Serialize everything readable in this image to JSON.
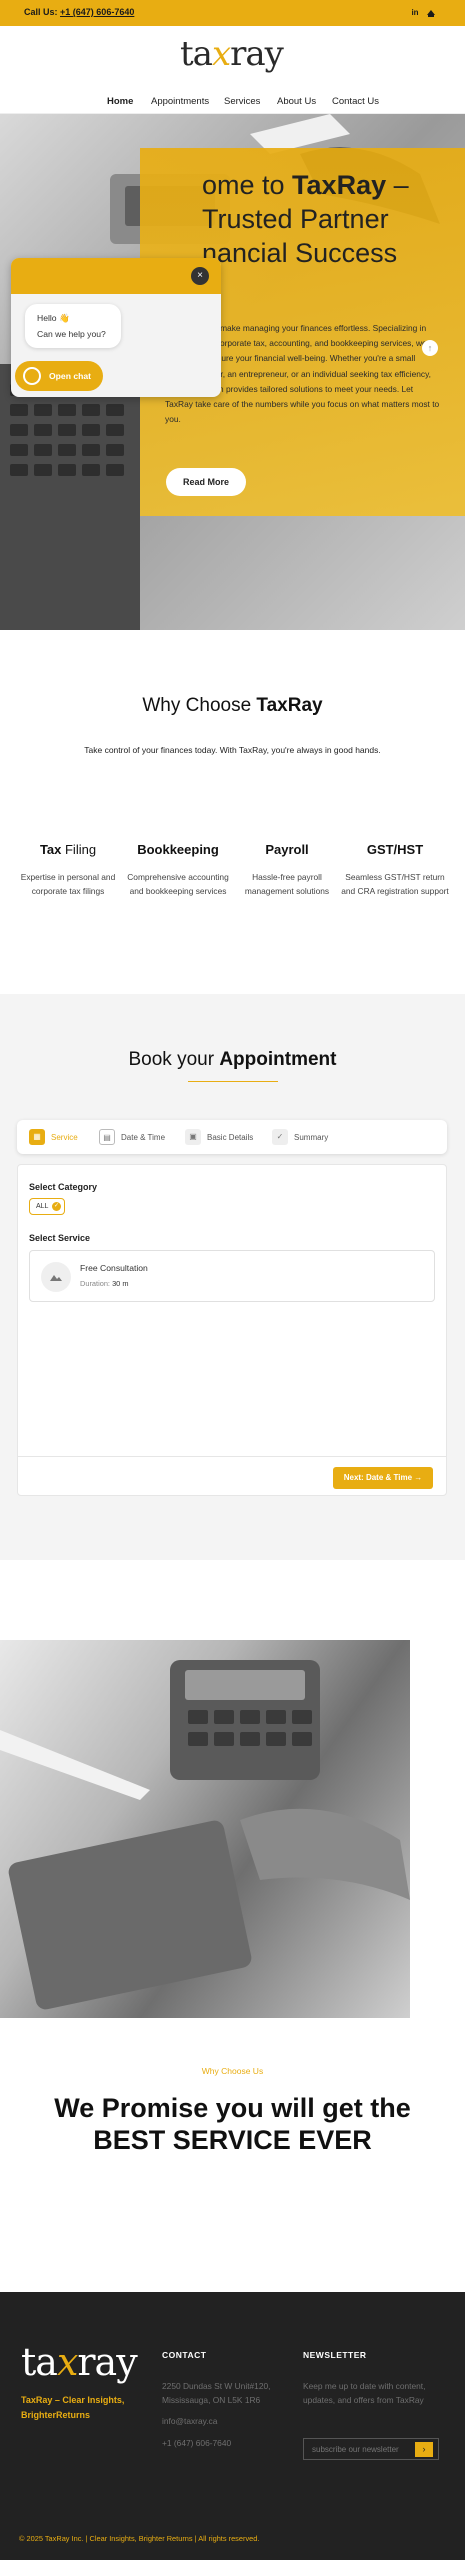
{
  "topbar": {
    "call_label": "Call Us:",
    "phone": "+1 (647) 606-7640",
    "social": [
      "in",
      "ig"
    ]
  },
  "brand": {
    "logo_left": "ta",
    "logo_x": "x",
    "logo_right": "ray",
    "accent": "#e8ad12"
  },
  "nav": {
    "items": [
      "Home",
      "Appointments",
      "Services",
      "About Us",
      "Contact Us"
    ]
  },
  "hero": {
    "title_l1_pre": "ome to ",
    "title_l1_bold": "TaxRay",
    "title_l1_post": " –",
    "title_l2": "Trusted Partner",
    "title_l3": "nancial Success",
    "text": "At TaxRay, we make managing your finances effortless. Specializing in personal and corporate tax, accounting, and bookkeeping services, we are here to ensure your financial well-being. Whether you're a small business owner, an entrepreneur, or an individual seeking tax efficiency, our expert team provides tailored solutions to meet your needs. Let TaxRay take care of the numbers while you focus on what matters most to you.",
    "cta": "Read More",
    "fab": "↑"
  },
  "chat": {
    "close": "×",
    "greeting_l1": "Hello 👋",
    "greeting_l2": "Can we help you?",
    "open_label": "Open chat"
  },
  "why": {
    "title_pre": "Why Choose ",
    "title_bold": "TaxRay",
    "subtitle": "Take control of your finances today. With TaxRay, you're always in good hands.",
    "services": [
      {
        "bold": "Tax",
        "rest": " Filing",
        "desc": "Expertise in personal and corporate tax filings"
      },
      {
        "bold": "Bookkeeping",
        "rest": "",
        "desc": "Comprehensive accounting and bookkeeping services"
      },
      {
        "bold": "Payroll",
        "rest": "",
        "desc": "Hassle-free payroll management solutions"
      },
      {
        "bold": "GST/HST",
        "rest": "",
        "desc": "Seamless GST/HST return and CRA registration support"
      }
    ]
  },
  "booking": {
    "title_pre": "Book your ",
    "title_bold": "Appointment",
    "steps": [
      "Service",
      "Date & Time",
      "Basic Details",
      "Summary"
    ],
    "select_category": "Select Category",
    "category_chip": "ALL",
    "select_service": "Select Service",
    "service_name": "Free Consultation",
    "duration_label": "Duration:",
    "duration_value": "30 m",
    "next_button": "Next: Date & Time →"
  },
  "promise": {
    "eyebrow": "Why Choose Us",
    "line1": "We Promise you will get the",
    "line2": "BEST SERVICE EVER"
  },
  "footer": {
    "tagline_l1": "TaxRay – Clear Insights,",
    "tagline_l2": "BrighterReturns",
    "contact_head": "CONTACT",
    "address_l1": "2250 Dundas St W Unit#120,",
    "address_l2": "Mississauga, ON L5K 1R6",
    "email": "info@taxray.ca",
    "phone": "+1 (647) 606-7640",
    "newsletter_head": "NEWSLETTER",
    "newsletter_text": "Keep me up to date with content, updates, and offers from TaxRay",
    "newsletter_placeholder": "subscribe our newsletter",
    "newsletter_go": "›",
    "copyright": "© 2025 TaxRay Inc. | Clear Insights, Brighter Returns | All rights reserved."
  }
}
